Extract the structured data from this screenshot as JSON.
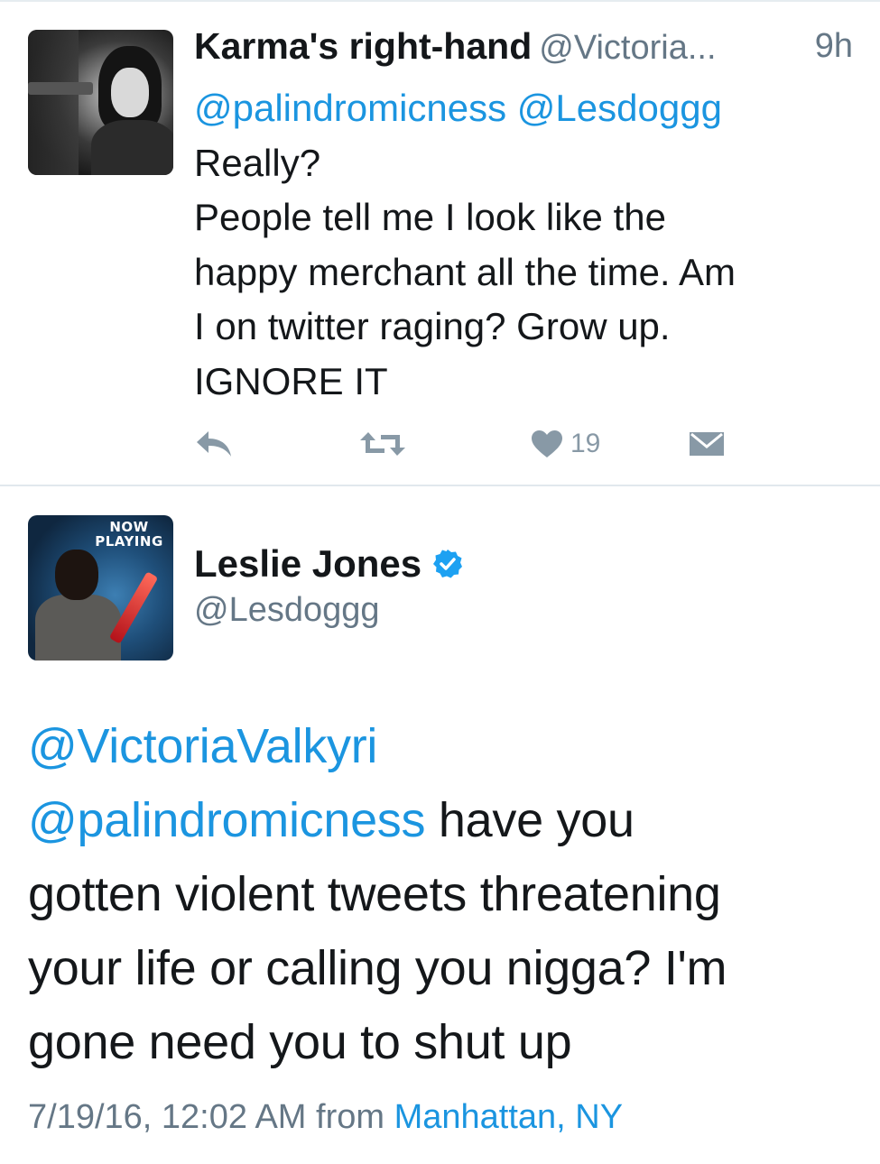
{
  "tweet1": {
    "display_name": "Karma's right-hand",
    "handle": "@Victoria...",
    "time": "9h",
    "mentions": [
      "@palindromicness",
      "@Lesdoggg"
    ],
    "lines": [
      "Really?",
      "People tell me I look like the",
      "happy merchant all the time. Am",
      "I on twitter raging? Grow up.",
      "IGNORE IT"
    ],
    "like_count": "19",
    "icons": [
      "reply-icon",
      "retweet-icon",
      "heart-icon",
      "message-icon"
    ]
  },
  "tweet2": {
    "avatar_badge": [
      "NOW",
      "PLAYING"
    ],
    "display_name": "Leslie Jones",
    "handle": "@Lesdoggg",
    "verified": true,
    "mention1": "@VictoriaValkyri",
    "mention2": "@palindromicness",
    "line2_rest": " have you",
    "lines": [
      "gotten violent tweets threatening",
      "your life or calling you nigga? I'm",
      "gone need you to shut up"
    ],
    "timestamp": "7/19/16, 12:02 AM from ",
    "location": "Manhattan, NY"
  },
  "colors": {
    "link": "#1b95e0",
    "text": "#14171a",
    "muted": "#657786",
    "action": "#8899a6",
    "verified": "#1da1f2",
    "divider": "#e1e8ed"
  }
}
